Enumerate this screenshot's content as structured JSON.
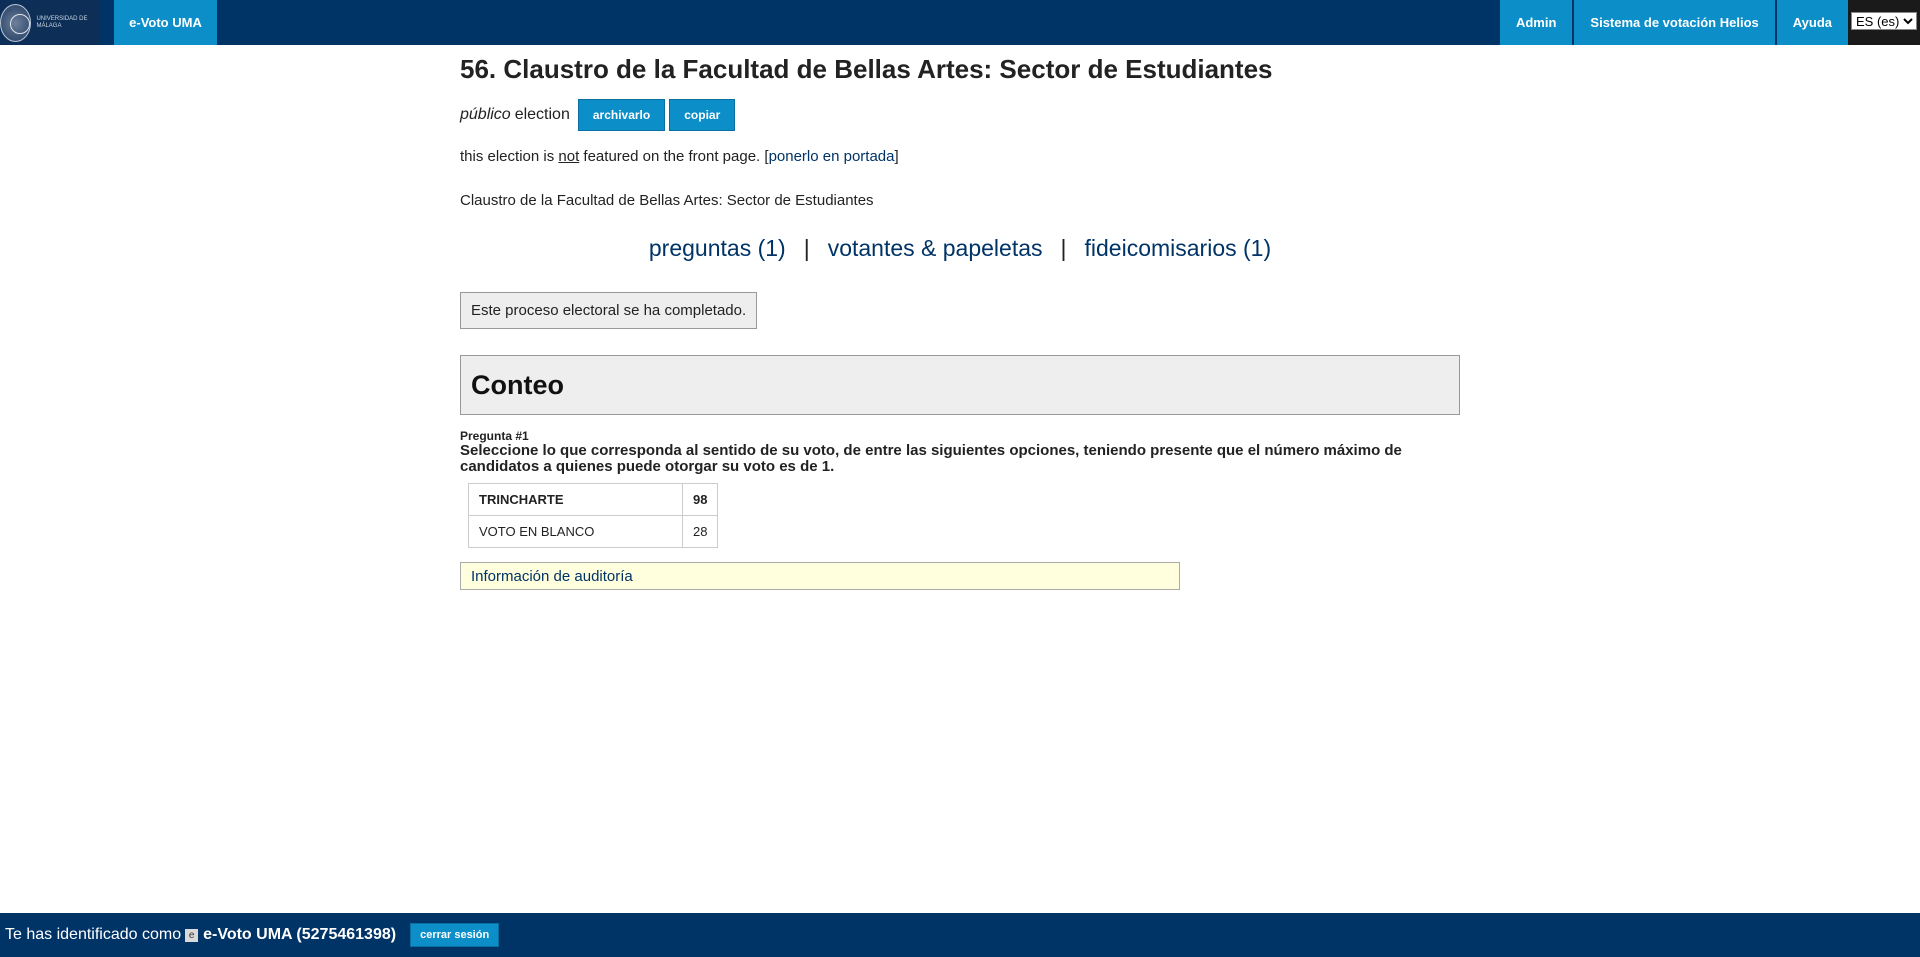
{
  "header": {
    "logo_text": "Universidad de Málaga",
    "brand": "e-Voto UMA",
    "nav": [
      "Admin",
      "Sistema de votación Helios",
      "Ayuda"
    ],
    "language": "ES (es)"
  },
  "election": {
    "title": "56. Claustro de la Facultad de Bellas Artes: Sector de Estudiantes",
    "visibility": "público",
    "election_word": "election",
    "archive_button": "archivarlo",
    "copy_button": "copiar",
    "featured_pre": "this election is",
    "featured_not": "not",
    "featured_post": "featured on the front page. [",
    "featured_link": "ponerlo en portada",
    "featured_close": "]",
    "description": "Claustro de la Facultad de Bellas Artes: Sector de Estudiantes",
    "links": {
      "questions": "preguntas (1)",
      "sep": "|",
      "voters": "votantes & papeletas",
      "trustees": "fideicomisarios (1)"
    },
    "completed_msg": "Este proceso electoral se ha completado.",
    "tally_title": "Conteo",
    "question_number": "Pregunta #1",
    "question_text": "Seleccione lo que corresponda al sentido de su voto, de entre las siguientes opciones, teniendo presente que el número máximo de candidatos a quienes puede otorgar su voto es de 1.",
    "results": [
      {
        "name": "TRINCHARTE",
        "count": "98"
      },
      {
        "name": "VOTO EN BLANCO",
        "count": "28"
      }
    ],
    "audit_link": "Información de auditoría"
  },
  "footer": {
    "identified_as": "Te has identificado como",
    "icon": "e",
    "user": "e-Voto UMA (5275461398)",
    "logout": "cerrar sesión"
  }
}
